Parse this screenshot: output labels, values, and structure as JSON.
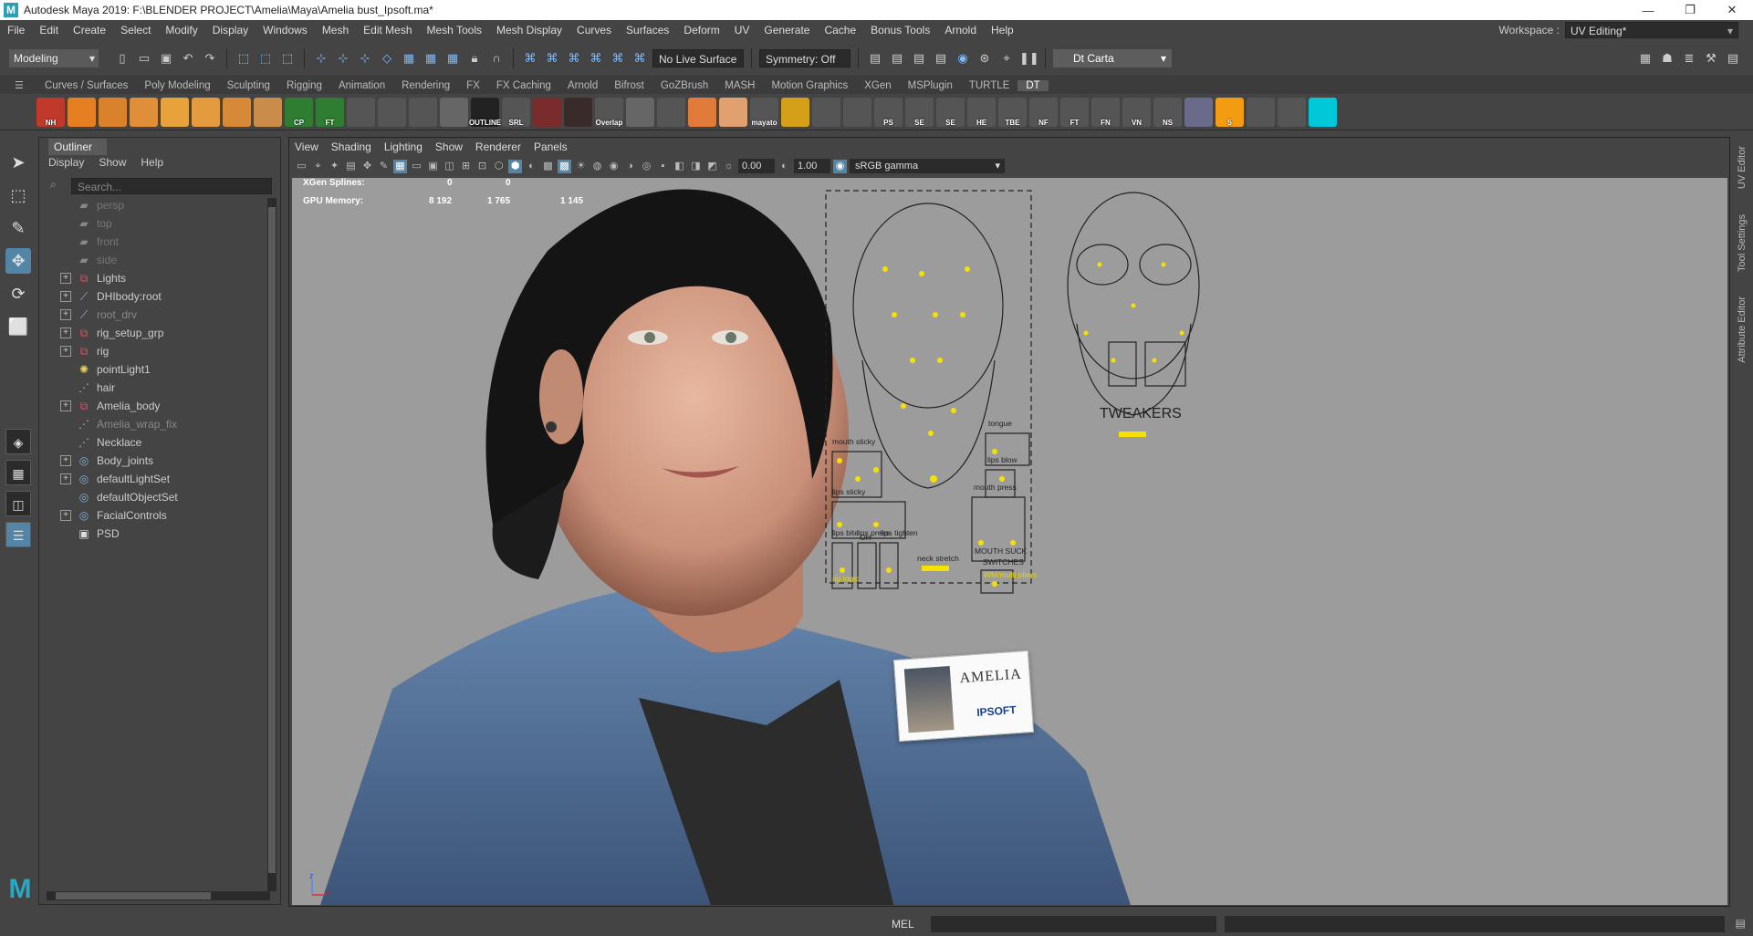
{
  "window": {
    "title": "Autodesk Maya 2019: F:\\BLENDER PROJECT\\Amelia\\Maya\\Amelia bust_Ipsoft.ma*",
    "logo": "M",
    "controls": [
      "minimize-icon",
      "restore-icon",
      "close-icon"
    ]
  },
  "menubar": {
    "items": [
      "File",
      "Edit",
      "Create",
      "Select",
      "Modify",
      "Display",
      "Windows",
      "Mesh",
      "Edit Mesh",
      "Mesh Tools",
      "Mesh Display",
      "Curves",
      "Surfaces",
      "Deform",
      "UV",
      "Generate",
      "Cache",
      "Bonus Tools",
      "Arnold",
      "Help"
    ],
    "workspace_label": "Workspace :",
    "workspace_value": "UV Editing*"
  },
  "statusline": {
    "mode": "Modeling",
    "live_surface": "No Live Surface",
    "symmetry": "Symmetry: Off",
    "user": "Dt Carta"
  },
  "shelf": {
    "tabs": [
      "Curves / Surfaces",
      "Poly Modeling",
      "Sculpting",
      "Rigging",
      "Animation",
      "Rendering",
      "FX",
      "FX Caching",
      "Arnold",
      "Bifrost",
      "GoZBrush",
      "MASH",
      "Motion Graphics",
      "XGen",
      "MSPlugin",
      "TURTLE",
      "DT"
    ],
    "active_tab": "DT",
    "icons": [
      {
        "label": "NH",
        "color": "#c0392b"
      },
      {
        "label": "",
        "color": "#e67e22"
      },
      {
        "label": "",
        "color": "#d9822b"
      },
      {
        "label": "",
        "color": "#e08e3a"
      },
      {
        "label": "",
        "color": "#e8a23c"
      },
      {
        "label": "",
        "color": "#e49b3e"
      },
      {
        "label": "",
        "color": "#d68a38"
      },
      {
        "label": "",
        "color": "#c98c4a"
      },
      {
        "label": "CP",
        "color": "#2e7d32"
      },
      {
        "label": "FT",
        "color": "#2e7d32"
      },
      {
        "label": "",
        "color": "#555555"
      },
      {
        "label": "",
        "color": "#555555"
      },
      {
        "label": "",
        "color": "#555555"
      },
      {
        "label": "",
        "color": "#666666"
      },
      {
        "label": "OUTLINE",
        "color": "#222222"
      },
      {
        "label": "SRL",
        "color": "#555555"
      },
      {
        "label": "",
        "color": "#7a2b2b"
      },
      {
        "label": "",
        "color": "#3a2b2b"
      },
      {
        "label": "Overlap",
        "color": "#555555"
      },
      {
        "label": "",
        "color": "#666666"
      },
      {
        "label": "",
        "color": "#555555"
      },
      {
        "label": "",
        "color": "#e07b3a"
      },
      {
        "label": "",
        "color": "#e0a070"
      },
      {
        "label": "mayato",
        "color": "#555555"
      },
      {
        "label": "",
        "color": "#d4a017"
      },
      {
        "label": "",
        "color": "#555555"
      },
      {
        "label": "",
        "color": "#555555"
      },
      {
        "label": "PS",
        "color": "#555555"
      },
      {
        "label": "SE",
        "color": "#555555"
      },
      {
        "label": "SE",
        "color": "#555555"
      },
      {
        "label": "HE",
        "color": "#555555"
      },
      {
        "label": "TBE",
        "color": "#555555"
      },
      {
        "label": "NF",
        "color": "#555555"
      },
      {
        "label": "FT",
        "color": "#555555"
      },
      {
        "label": "FN",
        "color": "#555555"
      },
      {
        "label": "VN",
        "color": "#555555"
      },
      {
        "label": "NS",
        "color": "#555555"
      },
      {
        "label": "",
        "color": "#6a6a8a"
      },
      {
        "label": "5",
        "color": "#f39c12"
      },
      {
        "label": "",
        "color": "#555555"
      },
      {
        "label": "",
        "color": "#555555"
      },
      {
        "label": "",
        "color": "#00c8d8"
      }
    ]
  },
  "outliner": {
    "tab": "Outliner",
    "menu": [
      "Display",
      "Show",
      "Help"
    ],
    "search_placeholder": "Search...",
    "items": [
      {
        "label": "persp",
        "icon": "camera-icon",
        "style": "cam",
        "expandable": false
      },
      {
        "label": "top",
        "icon": "camera-icon",
        "style": "cam",
        "expandable": false
      },
      {
        "label": "front",
        "icon": "camera-icon",
        "style": "cam",
        "expandable": false
      },
      {
        "label": "side",
        "icon": "camera-icon",
        "style": "cam",
        "expandable": false
      },
      {
        "label": "Lights",
        "icon": "group-icon",
        "style": "normal",
        "expandable": true
      },
      {
        "label": "DHIbody:root",
        "icon": "joint-icon",
        "style": "normal",
        "expandable": true
      },
      {
        "label": "root_drv",
        "icon": "joint-icon",
        "style": "dim",
        "expandable": true
      },
      {
        "label": "rig_setup_grp",
        "icon": "group-icon",
        "style": "normal",
        "expandable": true
      },
      {
        "label": "rig",
        "icon": "group-icon",
        "style": "normal",
        "expandable": true
      },
      {
        "label": "pointLight1",
        "icon": "light-icon",
        "style": "normal",
        "expandable": false
      },
      {
        "label": "hair",
        "icon": "mesh-icon",
        "style": "normal",
        "expandable": false
      },
      {
        "label": "Amelia_body",
        "icon": "group-icon",
        "style": "normal",
        "expandable": true
      },
      {
        "label": "Amelia_wrap_fix",
        "icon": "mesh-icon",
        "style": "dim",
        "expandable": false
      },
      {
        "label": "Necklace",
        "icon": "mesh-icon",
        "style": "normal",
        "expandable": false
      },
      {
        "label": "Body_joints",
        "icon": "set-icon",
        "style": "normal",
        "expandable": true
      },
      {
        "label": "defaultLightSet",
        "icon": "set-icon",
        "style": "normal",
        "expandable": true
      },
      {
        "label": "defaultObjectSet",
        "icon": "set-icon",
        "style": "normal",
        "expandable": false
      },
      {
        "label": "FacialControls",
        "icon": "set-icon",
        "style": "normal",
        "expandable": true
      },
      {
        "label": "PSD",
        "icon": "psd-icon",
        "style": "normal",
        "expandable": false
      }
    ]
  },
  "viewport": {
    "menu": [
      "View",
      "Shading",
      "Lighting",
      "Show",
      "Renderer",
      "Panels"
    ],
    "exposure": "0.00",
    "gamma": "1.00",
    "color_space": "sRGB gamma",
    "hud": {
      "xgen_label": "XGen Splines:",
      "xgen_values": [
        "0",
        "0"
      ],
      "gpu_label": "GPU Memory:",
      "gpu_values": [
        "8 192",
        "1 765",
        "1 145"
      ]
    },
    "badge_name": "AMELIA",
    "badge_brand": "IPSOFT",
    "axis_labels": [
      "z",
      "x"
    ]
  },
  "rig": {
    "left_labels": [
      "mouth sticky",
      "tongue",
      "lips blow",
      "lips sticky",
      "mouth press",
      "OH",
      "lips bite",
      "lips press",
      "lips tighten",
      "MOUTH SUCK",
      "neck stretch",
      "SWITCHES",
      "rig logic",
      "WM/multi pliers"
    ],
    "right_title": "TWEAKERS"
  },
  "right_tabs": [
    "UV Editor",
    "Tool Settings",
    "Attribute Editor"
  ],
  "cmdline": {
    "lang": "MEL"
  }
}
